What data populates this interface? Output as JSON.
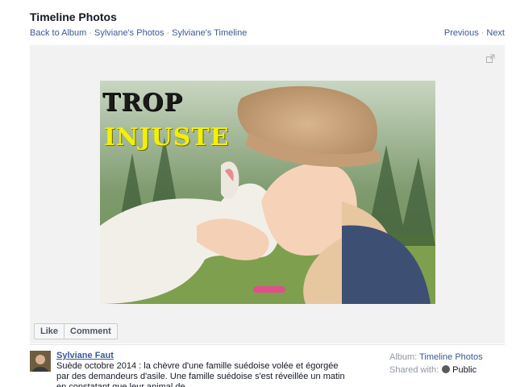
{
  "header": {
    "title": "Timeline Photos"
  },
  "breadcrumb": {
    "items": [
      "Back to Album",
      "Sylviane's Photos",
      "Sylviane's Timeline"
    ],
    "separator": "·"
  },
  "pager": {
    "previous": "Previous",
    "next": "Next",
    "separator": "·"
  },
  "photo": {
    "overlay_line1": "TROP",
    "overlay_line2": "INJUSTE"
  },
  "actions": {
    "like": "Like",
    "comment": "Comment"
  },
  "post": {
    "author": "Sylviane Faut",
    "text": "Suède octobre 2014 : la chèvre d'une famille suédoise volée et égorgée par des demandeurs d'asile. Une famille suédoise s'est réveillée un matin en constatant que leur animal de"
  },
  "meta": {
    "album_label": "Album:",
    "album_value": "Timeline Photos",
    "shared_label": "Shared with:",
    "shared_value": "Public"
  },
  "colors": {
    "link": "#3b5998",
    "stage_bg": "#f2f2f2",
    "overlay_yellow": "#f3f000"
  },
  "icons": [
    "expand-icon",
    "globe-icon"
  ]
}
